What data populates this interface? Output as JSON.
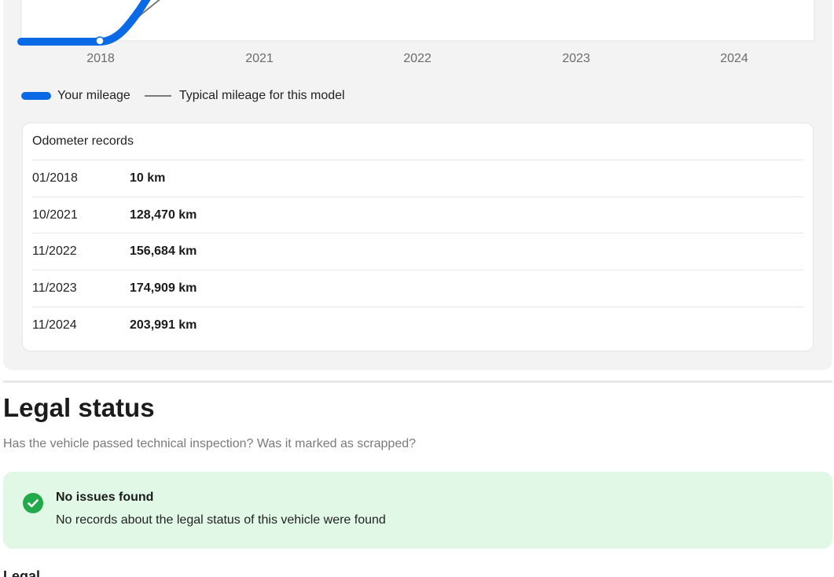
{
  "mileage": {
    "x_ticks": [
      "2018",
      "2021",
      "2022",
      "2023",
      "2024"
    ],
    "legend": {
      "yours": "Your mileage",
      "typical": "Typical mileage for this model"
    },
    "colors": {
      "yours": "#0a6ae6",
      "typical": "#7a7a7a"
    },
    "records_title": "Odometer records",
    "records": [
      {
        "date": "01/2018",
        "value": "10 km"
      },
      {
        "date": "10/2021",
        "value": "128,470 km"
      },
      {
        "date": "11/2022",
        "value": "156,684 km"
      },
      {
        "date": "11/2023",
        "value": "174,909 km"
      },
      {
        "date": "11/2024",
        "value": "203,991 km"
      }
    ]
  },
  "legal": {
    "title": "Legal status",
    "subtitle": "Has the vehicle passed technical inspection? Was it marked as scrapped?",
    "status": {
      "icon": "check-circle-icon",
      "heading": "No issues found",
      "body": "No records about the legal status of this vehicle were found",
      "color": "#21a94a",
      "background": "#e1f8e6"
    }
  },
  "next_section": {
    "title": "Legal"
  }
}
